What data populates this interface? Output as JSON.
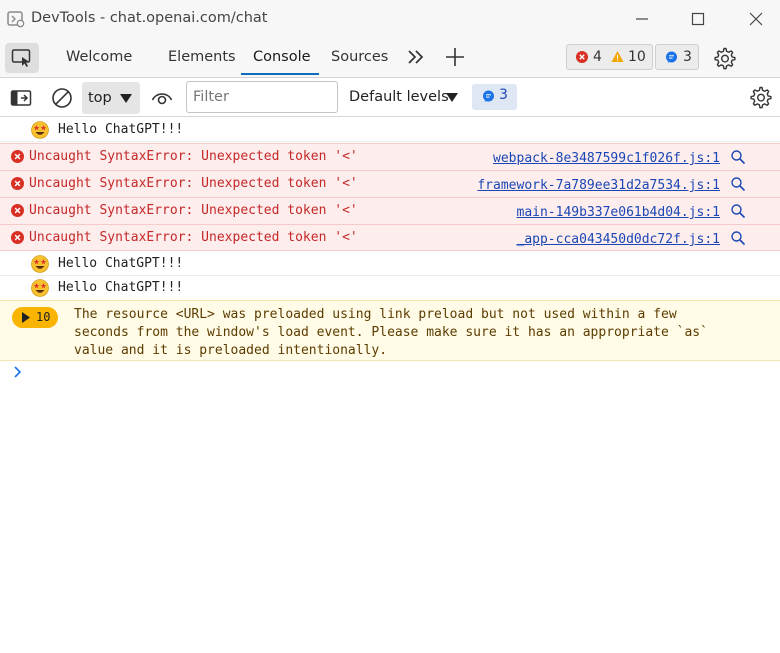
{
  "window": {
    "title": "DevTools - chat.openai.com/chat"
  },
  "tabs": [
    {
      "label": "Welcome"
    },
    {
      "label": "Elements"
    },
    {
      "label": "Console"
    },
    {
      "label": "Sources"
    }
  ],
  "issues": {
    "errors": "4",
    "warnings": "10",
    "messages": "3"
  },
  "toolbar": {
    "context": "top",
    "filter_placeholder": "Filter",
    "levels": "Default levels",
    "message_count": "3"
  },
  "console": {
    "log_text": "Hello ChatGPT!!!",
    "errors": [
      {
        "text": "Uncaught SyntaxError: Unexpected token '<'",
        "source": "webpack-8e3487599c1f026f.js:1"
      },
      {
        "text": "Uncaught SyntaxError: Unexpected token '<'",
        "source": "framework-7a789ee31d2a7534.js:1"
      },
      {
        "text": "Uncaught SyntaxError: Unexpected token '<'",
        "source": "main-149b337e061b4d04.js:1"
      },
      {
        "text": "Uncaught SyntaxError: Unexpected token '<'",
        "source": "_app-cca043450d0dc72f.js:1"
      }
    ],
    "warning": {
      "repeat_count": "10",
      "lines": [
        "The resource <URL> was preloaded using link preload but not used within a few",
        "seconds from the window's load event. Please make sure it has an appropriate `as`",
        "value and it is preloaded intentionally."
      ]
    }
  },
  "colors": {
    "accent": "#0f6cbd",
    "error_text": "#c62828",
    "error_bg": "#fdeded",
    "warning_bg": "#fffbe6",
    "warning_badge": "#f9b400",
    "link": "#1a47b5"
  }
}
